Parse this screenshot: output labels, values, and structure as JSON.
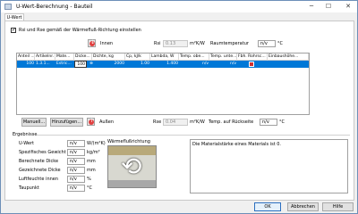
{
  "window": {
    "title": "U-Wert-Berechnung - Bauteil",
    "minimize": "─",
    "maximize": "☐",
    "close": "✕"
  },
  "tab": {
    "label": "U-Wert"
  },
  "top": {
    "checkbox_label": "Rsi und Rse gemäß der Wärmefluß-Richtung einstellen",
    "innen_label": "Innen",
    "rsi_label": "Rsi",
    "rsi_value": "0.13",
    "rsi_unit": "m²K/W",
    "raumtemp_label": "Raumtemperatur",
    "raumtemp_value": "n/v",
    "raumtemp_unit": "°C"
  },
  "grid": {
    "columns": [
      "Anteil ...",
      "Artikelnr.",
      "Mate...",
      "Dicke...",
      "Dichte, kg",
      "Cp, kJ/k",
      "Lambda, W",
      "Temp. obe...",
      "Temp. unte...",
      "Fbh. Rohrsc...",
      "Einbaushöhe..."
    ],
    "row": {
      "anteil": "100",
      "artikel": "1.3.1...",
      "material": "Estric...",
      "dicke": "100",
      "dichte": "2000",
      "cp": "1.00",
      "lambda": "1.400",
      "temp_oben": "n/v",
      "temp_unten": "n/v",
      "fbh": "",
      "einbau": ""
    }
  },
  "bottom_buttons": {
    "manuell": "Manuell...",
    "hinzufuegen": "Hinzufügen...",
    "aussen_label": "Außen",
    "rse_label": "Rse",
    "rse_value": "0.04",
    "rse_unit": "m²K/W",
    "ruecktemp_label": "Temp. auf Rückseite",
    "ruecktemp_value": "n/v",
    "ruecktemp_unit": "°C"
  },
  "ergebnisse": {
    "title": "Ergebnisse",
    "rows": [
      {
        "label": "U-Wert",
        "value": "n/v",
        "unit": "W/(m²K)"
      },
      {
        "label": "Spezifisches Gewicht",
        "value": "n/v",
        "unit": "kg/m²"
      },
      {
        "label": "Berechnete Dicke",
        "value": "n/v",
        "unit": "mm"
      },
      {
        "label": "Gezeichnete Dicke",
        "value": "n/v",
        "unit": "mm"
      },
      {
        "label": "Luftfeuchte innen",
        "value": "n/v",
        "unit": "%"
      },
      {
        "label": "Taupunkt",
        "value": "n/v",
        "unit": "°C"
      }
    ],
    "waermefluss_label": "Wärmeflußrichtung",
    "notes_text": "Die Materialstärke eines Materials ist 0."
  },
  "dialog_buttons": {
    "ok": "OK",
    "abbrechen": "Abbrechen",
    "hilfe": "Hilfe"
  }
}
